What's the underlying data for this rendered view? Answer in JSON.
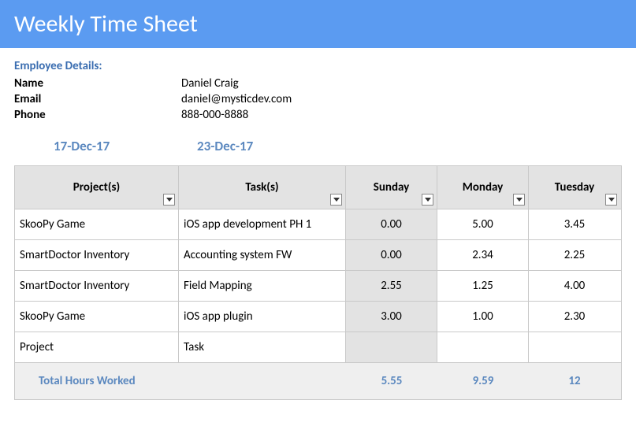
{
  "header": {
    "title": "Weekly Time Sheet"
  },
  "details": {
    "heading": "Employee Details:",
    "rows": [
      {
        "label": "Name",
        "value": "Daniel Craig"
      },
      {
        "label": "Email",
        "value": "daniel@mysticdev.com"
      },
      {
        "label": "Phone",
        "value": "888-000-8888"
      }
    ]
  },
  "dates": {
    "start": "17-Dec-17",
    "end": "23-Dec-17"
  },
  "table": {
    "headers": {
      "project": "Project(s)",
      "task": "Task(s)",
      "sunday": "Sunday",
      "monday": "Monday",
      "tuesday": "Tuesday"
    },
    "rows": [
      {
        "project": "SkooPy Game",
        "task": "iOS app development PH 1",
        "sunday": "0.00",
        "monday": "5.00",
        "tuesday": "3.45"
      },
      {
        "project": "SmartDoctor Inventory",
        "task": "Accounting system FW",
        "sunday": "0.00",
        "monday": "2.34",
        "tuesday": "2.25"
      },
      {
        "project": "SmartDoctor Inventory",
        "task": "Field Mapping",
        "sunday": "2.55",
        "monday": "1.25",
        "tuesday": "4.00"
      },
      {
        "project": "SkooPy Game",
        "task": "iOS app plugin",
        "sunday": "3.00",
        "monday": "1.00",
        "tuesday": "2.30"
      },
      {
        "project": "Project",
        "task": "Task",
        "sunday": "",
        "monday": "",
        "tuesday": ""
      }
    ],
    "total": {
      "label": "Total Hours Worked",
      "sunday": "5.55",
      "monday": "9.59",
      "tuesday": "12"
    }
  },
  "chart_data": {
    "type": "table",
    "title": "Weekly Time Sheet",
    "columns": [
      "Project(s)",
      "Task(s)",
      "Sunday",
      "Monday",
      "Tuesday"
    ],
    "rows": [
      [
        "SkooPy Game",
        "iOS app development PH 1",
        0.0,
        5.0,
        3.45
      ],
      [
        "SmartDoctor Inventory",
        "Accounting system FW",
        0.0,
        2.34,
        2.25
      ],
      [
        "SmartDoctor Inventory",
        "Field Mapping",
        2.55,
        1.25,
        4.0
      ],
      [
        "SkooPy Game",
        "iOS app plugin",
        3.0,
        1.0,
        2.3
      ]
    ],
    "totals": {
      "Sunday": 5.55,
      "Monday": 9.59,
      "Tuesday": 12
    }
  }
}
